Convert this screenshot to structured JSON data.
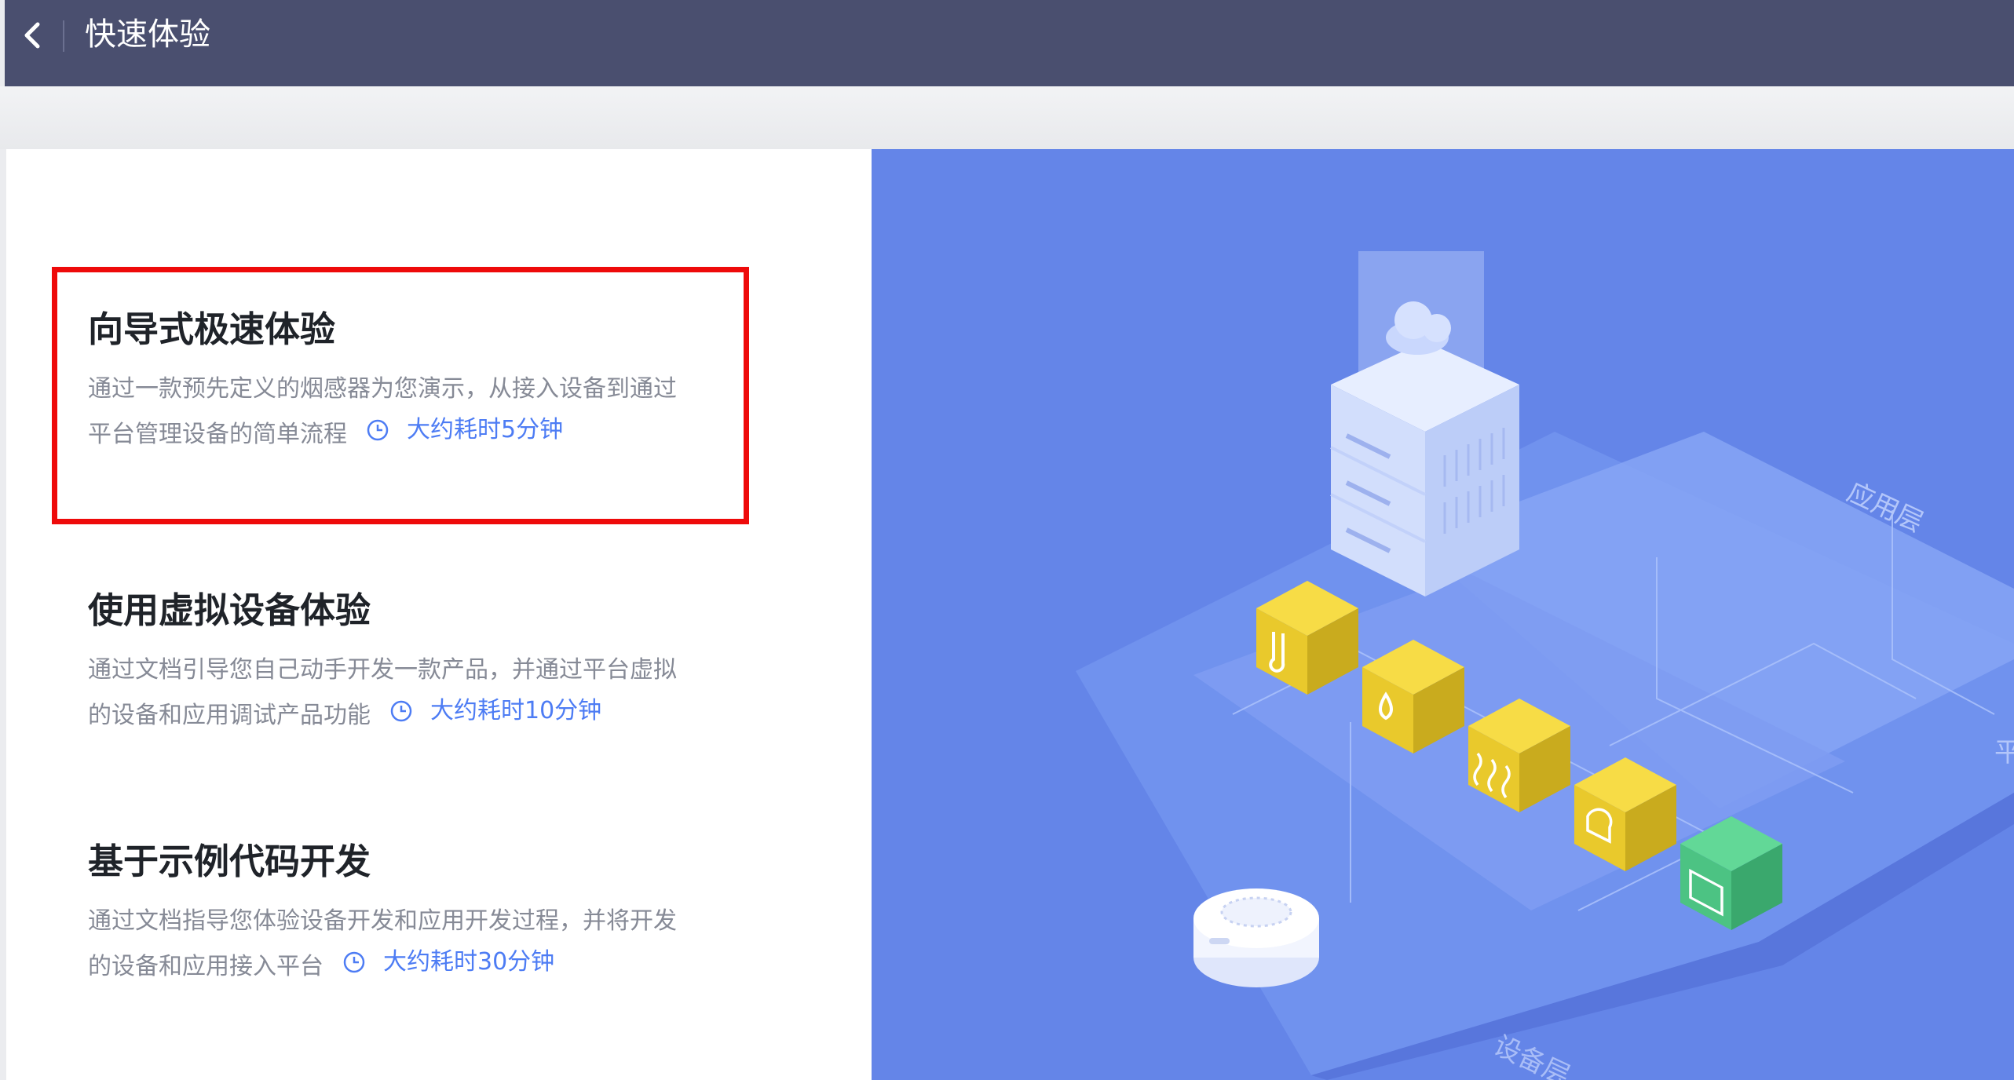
{
  "header": {
    "title": "快速体验"
  },
  "options": [
    {
      "title": "向导式极速体验",
      "desc": "通过一款预先定义的烟感器为您演示，从接入设备到通过平台管理设备的简单流程",
      "time": "大约耗时5分钟"
    },
    {
      "title": "使用虚拟设备体验",
      "desc": "通过文档引导您自己动手开发一款产品，并通过平台虚拟的设备和应用调试产品功能",
      "time": "大约耗时10分钟"
    },
    {
      "title": "基于示例代码开发",
      "desc": "通过文档指导您体验设备开发和应用开发过程，并将开发的设备和应用接入平台",
      "time": "大约耗时30分钟"
    }
  ],
  "illustration": {
    "label_app": "应用层",
    "label_device": "设备层",
    "label_platform": "平"
  },
  "colors": {
    "header_bg": "#4a4f6f",
    "accent": "#4d7cf4",
    "highlight": "#ee0a0a",
    "illustration_bg": "#6485e8",
    "cube_yellow": "#f2d12e",
    "cube_green": "#52c98a"
  },
  "icons": [
    "chevron-left-icon",
    "clock-icon",
    "thermometer-icon",
    "water-drop-icon",
    "steam-icon",
    "alarm-icon",
    "code-icon",
    "cloud-icon",
    "server-icon",
    "smoke-detector-icon"
  ]
}
